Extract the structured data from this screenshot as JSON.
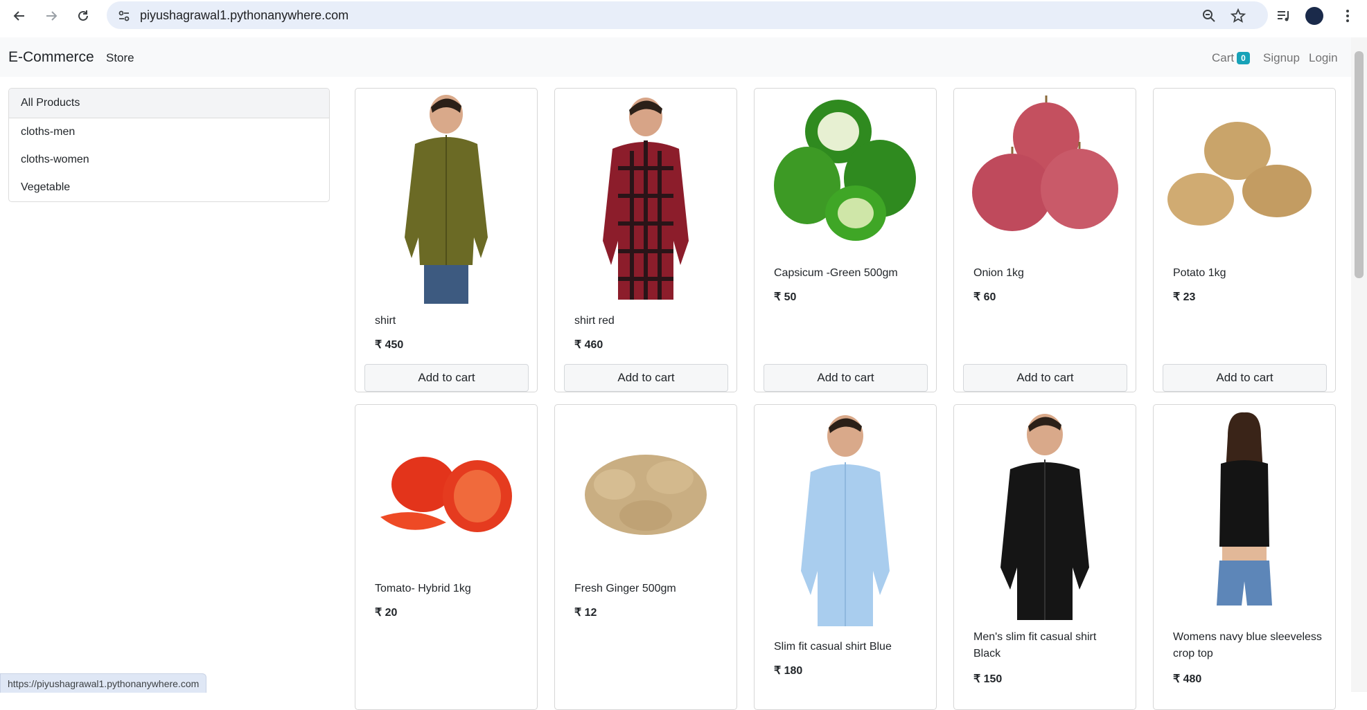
{
  "browser": {
    "url": "piyushagrawal1.pythonanywhere.com",
    "status_url": "https://piyushagrawal1.pythonanywhere.com"
  },
  "navbar": {
    "brand": "E-Commerce",
    "store": "Store",
    "cart_label": "Cart",
    "cart_count": "0",
    "signup": "Signup",
    "login": "Login"
  },
  "categories": [
    {
      "label": "All Products"
    },
    {
      "label": "cloths-men"
    },
    {
      "label": "cloths-women"
    },
    {
      "label": "Vegetable"
    }
  ],
  "currency": "₹",
  "products": [
    {
      "name": "shirt",
      "price": "₹ 450",
      "button": "Add to cart"
    },
    {
      "name": "shirt red",
      "price": "₹ 460",
      "button": "Add to cart"
    },
    {
      "name": "Capsicum -Green 500gm",
      "price": "₹ 50",
      "button": "Add to cart"
    },
    {
      "name": "Onion 1kg",
      "price": "₹ 60",
      "button": "Add to cart"
    },
    {
      "name": "Potato 1kg",
      "price": "₹ 23",
      "button": "Add to cart"
    },
    {
      "name": "Tomato- Hybrid 1kg",
      "price": "₹ 20"
    },
    {
      "name": "Fresh Ginger 500gm",
      "price": "₹ 12"
    },
    {
      "name": "Slim fit casual shirt Blue",
      "price": "₹ 180"
    },
    {
      "name": "Men's slim fit casual shirt Black",
      "price": "₹ 150"
    },
    {
      "name": "Womens navy blue sleeveless crop top",
      "price": "₹ 480"
    }
  ],
  "colors": {
    "navbar_bg": "#f8f9fa",
    "badge": "#17a2b8",
    "omnibox": "#e8eef9"
  }
}
